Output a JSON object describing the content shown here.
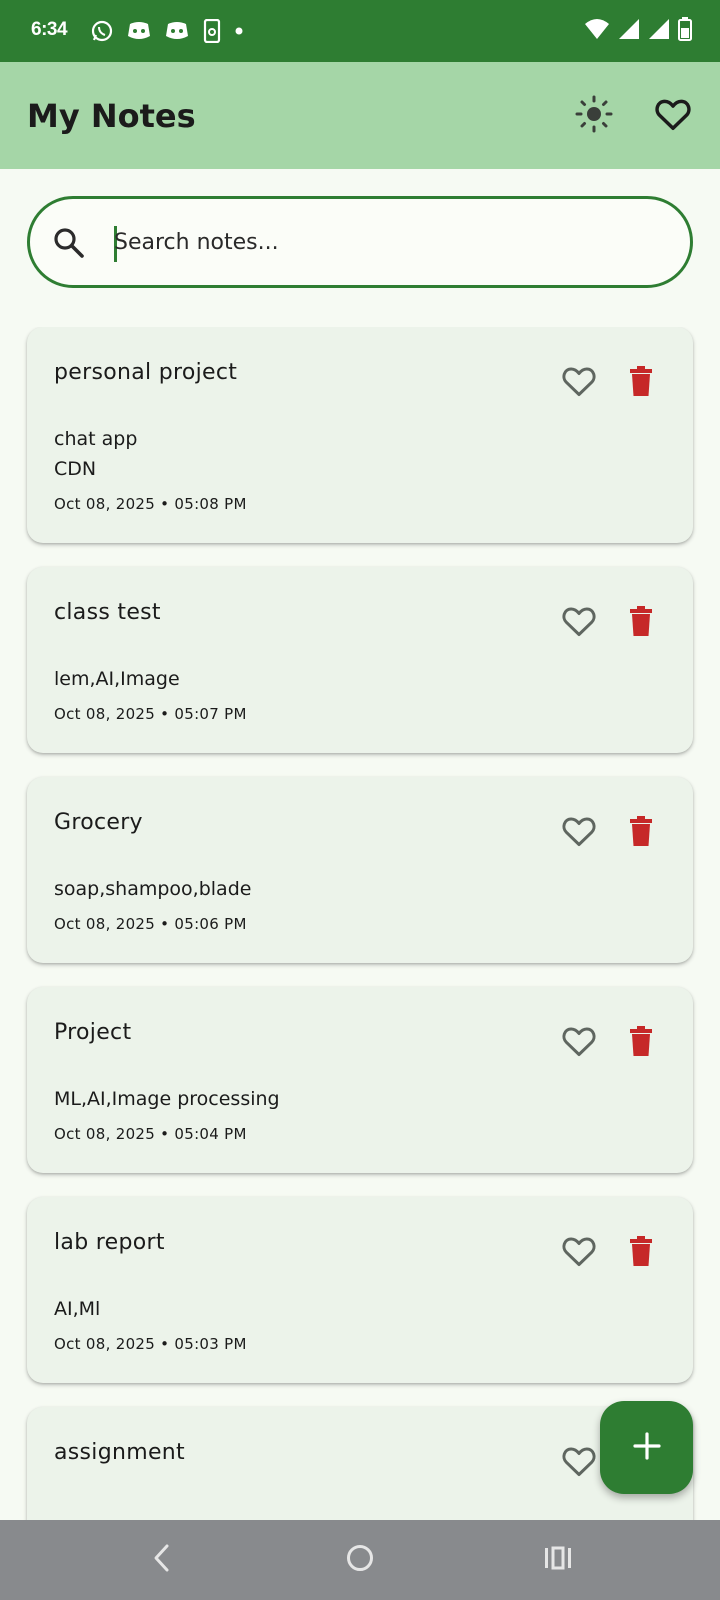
{
  "status_bar": {
    "time": "6:34",
    "left_icons": [
      "whatsapp-icon",
      "discord-icon",
      "discord-icon",
      "phone-link-icon",
      "dot-icon"
    ],
    "right_icons": [
      "wifi-icon",
      "signal-icon",
      "signal-icon",
      "battery-icon"
    ]
  },
  "app_bar": {
    "title": "My Notes",
    "actions": [
      "theme-toggle-icon",
      "favorites-icon"
    ]
  },
  "search": {
    "placeholder": "Search notes...",
    "value": ""
  },
  "notes": [
    {
      "title": "personal project",
      "body": "chat app\nCDN",
      "date": "Oct 08, 2025 • 05:08 PM"
    },
    {
      "title": "class test",
      "body": "lem,AI,Image",
      "date": "Oct 08, 2025 • 05:07 PM"
    },
    {
      "title": "Grocery",
      "body": "soap,shampoo,blade",
      "date": "Oct 08, 2025 • 05:06 PM"
    },
    {
      "title": "Project",
      "body": "ML,AI,Image processing",
      "date": "Oct 08, 2025 • 05:04 PM"
    },
    {
      "title": "lab report",
      "body": "AI,Ml",
      "date": "Oct 08, 2025 • 05:03 PM"
    },
    {
      "title": "assignment",
      "body": "",
      "date": ""
    }
  ],
  "fab": {
    "icon": "plus-icon"
  },
  "colors": {
    "status_bar": "#2e7d32",
    "app_bar": "#a5d6a7",
    "accent": "#2e7d32",
    "card": "#ecf3ea",
    "delete": "#c62828",
    "heart": "#5f6660",
    "nav_bar": "#888a8d"
  }
}
